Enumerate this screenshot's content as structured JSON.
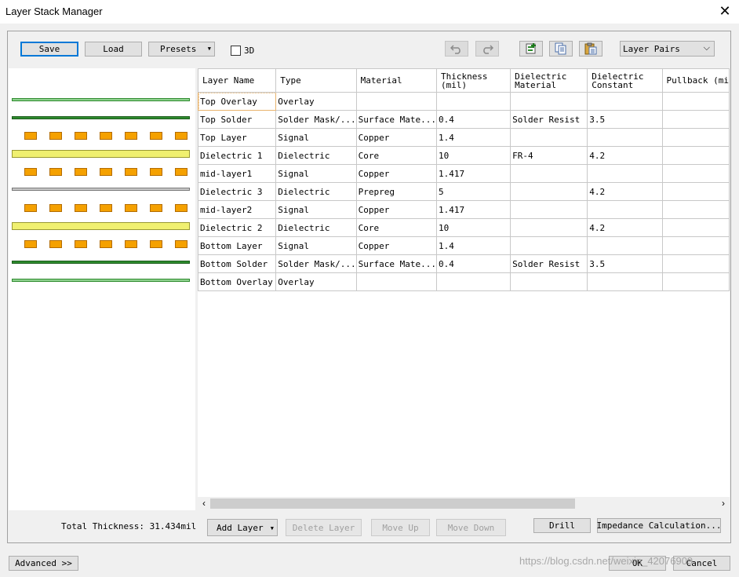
{
  "window": {
    "title": "Layer Stack Manager"
  },
  "toolbar": {
    "save_label": "Save",
    "load_label": "Load",
    "presets_label": "Presets",
    "three_d_label": "3D",
    "three_d_checked": false,
    "view_select_value": "Layer Pairs"
  },
  "table": {
    "columns": [
      "Layer Name",
      "Type",
      "Material",
      "Thickness (mil)",
      "Dielectric Material",
      "Dielectric Constant",
      "Pullback (mi"
    ],
    "rows": [
      [
        "Top Overlay",
        "Overlay",
        "",
        "",
        "",
        "",
        ""
      ],
      [
        "Top Solder",
        "Solder Mask/...",
        "Surface Mate...",
        "0.4",
        "Solder Resist",
        "3.5",
        ""
      ],
      [
        "Top Layer",
        "Signal",
        "Copper",
        "1.4",
        "",
        "",
        ""
      ],
      [
        "Dielectric 1",
        "Dielectric",
        "Core",
        "10",
        "FR-4",
        "4.2",
        ""
      ],
      [
        "mid-layer1",
        "Signal",
        "Copper",
        "1.417",
        "",
        "",
        ""
      ],
      [
        "Dielectric 3",
        "Dielectric",
        "Prepreg",
        "5",
        "",
        "4.2",
        ""
      ],
      [
        "mid-layer2",
        "Signal",
        "Copper",
        "1.417",
        "",
        "",
        ""
      ],
      [
        "Dielectric 2",
        "Dielectric",
        "Core",
        "10",
        "",
        "4.2",
        ""
      ],
      [
        "Bottom Layer",
        "Signal",
        "Copper",
        "1.4",
        "",
        "",
        ""
      ],
      [
        "Bottom Solder",
        "Solder Mask/...",
        "Surface Mate...",
        "0.4",
        "Solder Resist",
        "3.5",
        ""
      ],
      [
        "Bottom Overlay",
        "Overlay",
        "",
        "",
        "",
        "",
        ""
      ]
    ]
  },
  "footer": {
    "total_thickness": "Total Thickness: 31.434mil",
    "add_layer": "Add Layer",
    "delete_layer": "Delete Layer",
    "move_up": "Move Up",
    "move_down": "Move Down",
    "drill": "Drill",
    "impedance": "Impedance Calculation..."
  },
  "bottom": {
    "advanced": "Advanced >>",
    "ok": "OK",
    "cancel": "Cancel",
    "watermark": "https://blog.csdn.net/weixin_42076909"
  },
  "colors": {
    "overlay": "#8fd18f",
    "solder": "#2e8b2e",
    "copper_pad": "#f5a100",
    "core": "#f0f070",
    "prepreg": "#c8c8c8",
    "accent": "#0078d7"
  },
  "icons": {
    "close": "close-icon",
    "undo": "undo-icon",
    "redo": "redo-icon",
    "add_layer": "add-layer-icon",
    "copy": "copy-icon",
    "paste": "paste-icon"
  }
}
